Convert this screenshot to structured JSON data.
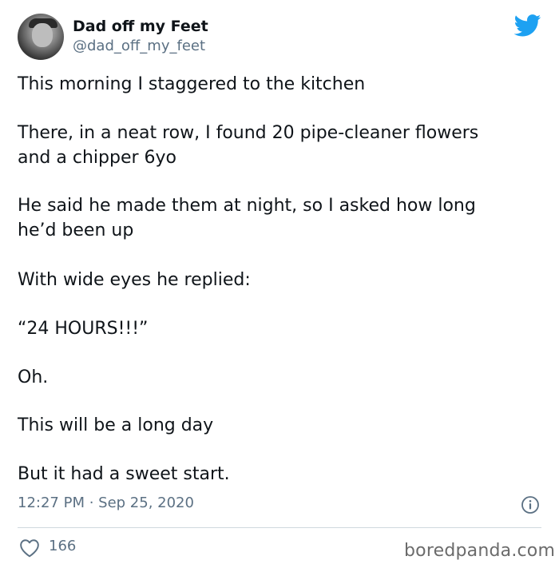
{
  "author": {
    "display_name": "Dad off my Feet",
    "handle": "@dad_off_my_feet",
    "avatar_icon": "profile-photo",
    "platform_icon": "twitter-bird-icon",
    "platform_color": "#1da1f2"
  },
  "tweet": {
    "lines": [
      "This morning I staggered to the kitchen",
      "There, in a neat row, I found 20 pipe-cleaner flowers",
      "and a chipper 6yo",
      "He said he made them at night, so I asked how long",
      "he’d been up",
      "With wide eyes he replied:",
      "“24 HOURS!!!”",
      "Oh.",
      "This will be a long day",
      "But it had a sweet start."
    ],
    "timestamp": "12:27 PM · Sep 25, 2020",
    "info_icon": "info-icon"
  },
  "engagement": {
    "like_icon": "heart-icon",
    "like_count": "166"
  },
  "watermark": "boredpanda.com"
}
